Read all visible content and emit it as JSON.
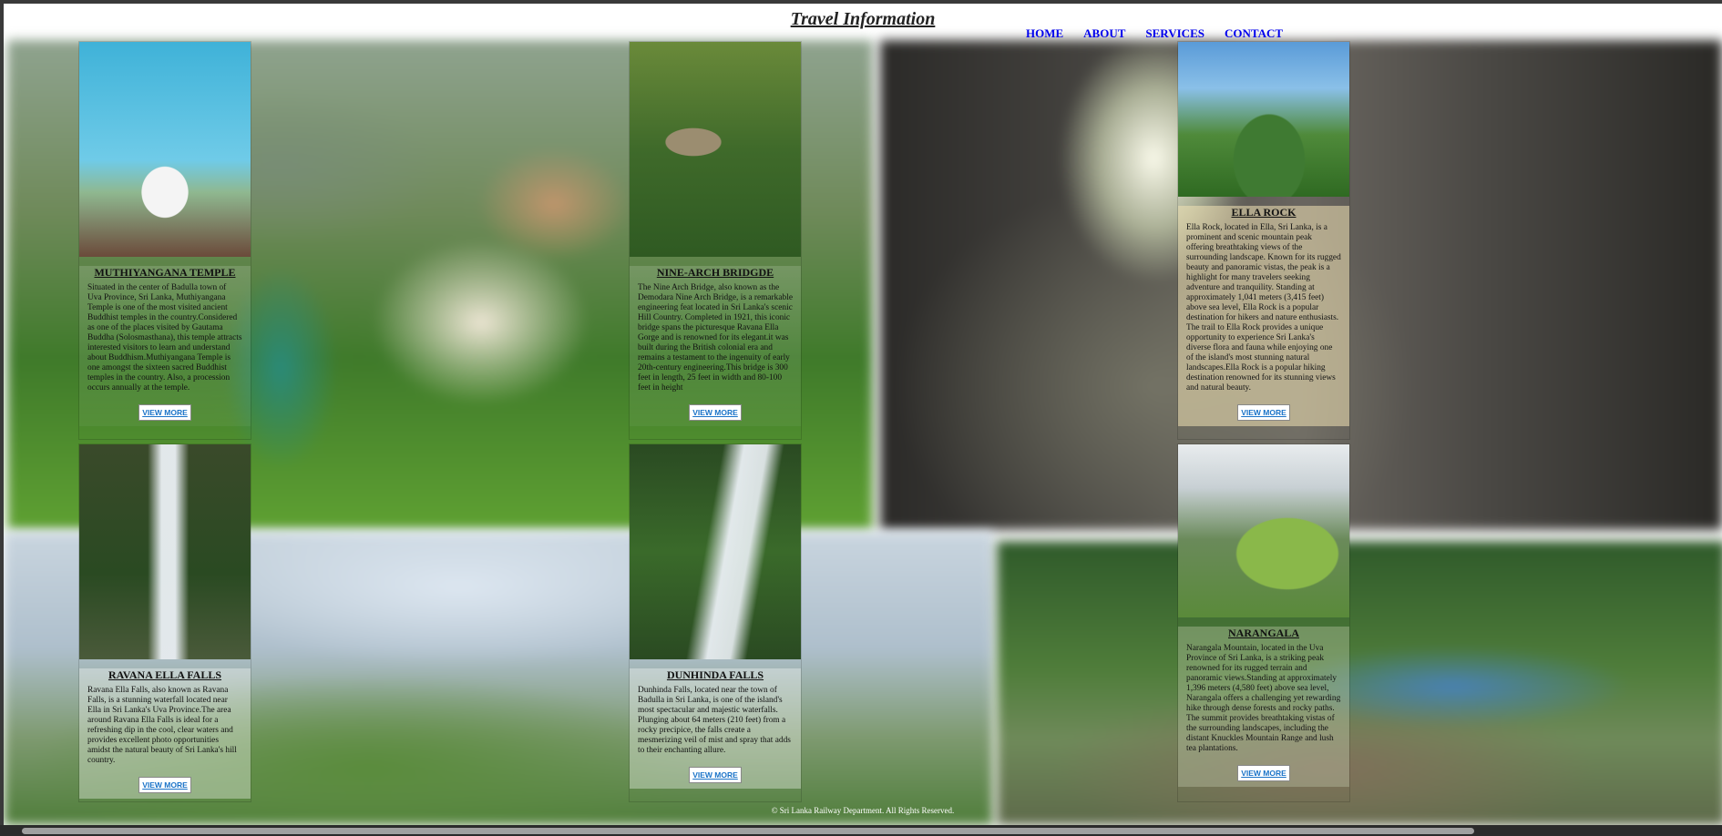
{
  "header": {
    "title": "Travel Information"
  },
  "nav": {
    "items": [
      "HOME",
      "ABOUT",
      "SERVICES",
      "CONTACT"
    ]
  },
  "cards": [
    {
      "title": "MUTHIYANGANA TEMPLE",
      "text": "Situated in the center of Badulla town of Uva Province, Sri Lanka, Muthiyangana Temple is one of the most visited ancient Buddhist temples in the country.Considered as one of the places visited by Gautama Buddha (Solosmasthana), this temple attracts interested visitors to learn and understand about Buddhism.Muthiyangana Temple is one amongst the sixteen sacred Buddhist temples in the country. Also, a procession occurs annually at the temple.",
      "button": "VIEW MORE"
    },
    {
      "title": "NINE-ARCH BRIDGDE",
      "text": "The Nine Arch Bridge, also known as the Demodara Nine Arch Bridge, is a remarkable engineering feat located in Sri Lanka's scenic Hill Country. Completed in 1921, this iconic bridge spans the picturesque Ravana Ella Gorge and is renowned for its elegant.it was built during the British colonial era and remains a testament to the ingenuity of early 20th-century engineering.This bridge is 300 feet in length, 25 feet in width and 80-100 feet in height",
      "button": "VIEW MORE"
    },
    {
      "title": "ELLA ROCK",
      "text": "Ella Rock, located in Ella, Sri Lanka, is a prominent and scenic mountain peak offering breathtaking views of the surrounding landscape. Known for its rugged beauty and panoramic vistas, the peak is a highlight for many travelers seeking adventure and tranquility. Standing at approximately 1,041 meters (3,415 feet) above sea level, Ella Rock is a popular destination for hikers and nature enthusiasts. The trail to Ella Rock provides a unique opportunity to experience Sri Lanka's diverse flora and fauna while enjoying one of the island's most stunning natural landscapes.Ella Rock is a popular hiking destination renowned for its stunning views and natural beauty.",
      "button": "VIEW MORE"
    },
    {
      "title": "RAVANA ELLA FALLS",
      "text": "Ravana Ella Falls, also known as Ravana Falls, is a stunning waterfall located near Ella in Sri Lanka's Uva Province.The area around Ravana Ella Falls is ideal for a refreshing dip in the cool, clear waters and provides excellent photo opportunities amidst the natural beauty of Sri Lanka's hill country.",
      "button": "VIEW MORE"
    },
    {
      "title": "DUNHINDA FALLS",
      "text": "Dunhinda Falls, located near the town of Badulla in Sri Lanka, is one of the island's most spectacular and majestic waterfalls. Plunging about 64 meters (210 feet) from a rocky precipice, the falls create a mesmerizing veil of mist and spray that adds to their enchanting allure.",
      "button": "VIEW MORE"
    },
    {
      "title": "NARANGALA",
      "text": "Narangala Mountain, located in the Uva Province of Sri Lanka, is a striking peak renowned for its rugged terrain and panoramic views.Standing at approximately 1,396 meters (4,580 feet) above sea level, Narangala offers a challenging yet rewarding hike through dense forests and rocky paths. The summit provides breathtaking vistas of the surrounding landscapes, including the distant Knuckles Mountain Range and lush tea plantations.",
      "button": "VIEW MORE"
    }
  ],
  "footer": {
    "text": "© Sri Lanka Railway Department. All Rights Reserved."
  }
}
